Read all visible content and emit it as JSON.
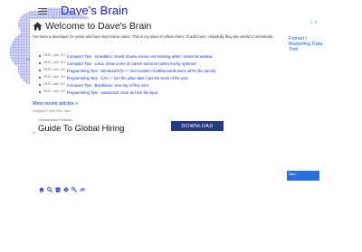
{
  "header": {
    "site_title": "Dave's Brain",
    "menu_icon": "hamburger-menu-icon",
    "background_icon": "brain-illustration"
  },
  "main": {
    "title_icon": "home-icon",
    "title": "Welcome to Dave's Brain",
    "intro": "I've been a developer for years and have kept some notes. This is my place to share them. I'll add more. Hopefully they are useful to somebody.",
    "articles": [
      {
        "date": "2021-jan-04",
        "title": "Computer Tips - VirtualBox: Guest Ubuntu screen not resizing when I resize its window"
      },
      {
        "date": "2021-jan-04",
        "title": "Computer Tips - Linux: show a tree of current services (units) run by systemd"
      },
      {
        "date": "2021-dec-04",
        "title": "Programming Tips - Windows/C/C++: Get number of milliseconds since 1970 (the epoch)"
      },
      {
        "date": "2021-dec-04",
        "title": "Programming Tips - C/C++: Get the julian date / get the week of the year"
      },
      {
        "date": "2021-dec-02",
        "title": "Computer Tips - Backblaze: view log of files sent"
      },
      {
        "date": "2021-dec-02",
        "title": "Programming Tips - JavaScript: clear an html file input"
      }
    ],
    "more_link": "More recent articles >",
    "copyright": "Copyright © 2006-2021, dave"
  },
  "ad_banner": {
    "org": "Globalization Partners",
    "headline": "Guide To Global Hiring",
    "button": "DOWNLOAD",
    "choice_icon": "ad-choices-icon"
  },
  "side_ad": {
    "text": "Funnel | Marketing Data Tool",
    "choice_mark": "▷ ✕",
    "button": "Start"
  },
  "footer": {
    "icons": [
      "home-icon",
      "search-icon",
      "archive-icon",
      "settings-icon",
      "key-icon",
      "link-icon"
    ]
  },
  "colors": {
    "brand_blue": "#0b1bd6",
    "link_blue": "#0b2fd6",
    "ad_button": "#233b83",
    "start_button": "#2a6fe0"
  }
}
